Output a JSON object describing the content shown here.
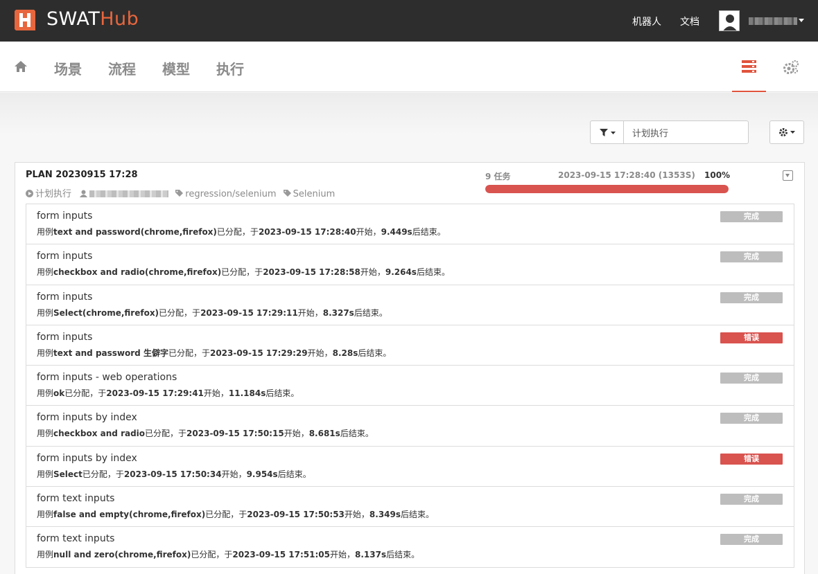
{
  "brand": {
    "part1": "SWAT",
    "part2": "Hub",
    "accent": "#e8663d"
  },
  "topbar": {
    "link_robot": "机器人",
    "link_docs": "文档"
  },
  "nav": {
    "home_icon": "home-icon",
    "items": [
      "场景",
      "流程",
      "模型",
      "执行"
    ],
    "active_icon": "list-icon",
    "settings_icon": "gears-icon"
  },
  "filter": {
    "value": "计划执行"
  },
  "plan": {
    "title": "PLAN 20230915 17:28",
    "type": "计划执行",
    "tag1": "regression/selenium",
    "tag2": "Selenium",
    "task_count": "9 任务",
    "started": "2023-09-15 17:28:40 (1353S)",
    "percent": "100%",
    "progress": 1.0
  },
  "tasks": [
    {
      "name": "form inputs",
      "pre": "用例",
      "case": "text and password(chrome,firefox)",
      "mid": "已分配，于",
      "time": "2023-09-15 17:28:40",
      "mid2": "开始，",
      "dur": "9.449s",
      "post": "后结束。",
      "status": "完成",
      "state": "done"
    },
    {
      "name": "form inputs",
      "pre": "用例",
      "case": "checkbox and radio(chrome,firefox)",
      "mid": "已分配，于",
      "time": "2023-09-15 17:28:58",
      "mid2": "开始，",
      "dur": "9.264s",
      "post": "后结束。",
      "status": "完成",
      "state": "done"
    },
    {
      "name": "form inputs",
      "pre": "用例",
      "case": "Select(chrome,firefox)",
      "mid": "已分配，于",
      "time": "2023-09-15 17:29:11",
      "mid2": "开始，",
      "dur": "8.327s",
      "post": "后结束。",
      "status": "完成",
      "state": "done"
    },
    {
      "name": "form inputs",
      "pre": "用例",
      "case": "text and password 生僻字",
      "mid": "已分配，于",
      "time": "2023-09-15 17:29:29",
      "mid2": "开始，",
      "dur": "8.28s",
      "post": "后结束。",
      "status": "错误",
      "state": "err"
    },
    {
      "name": "form inputs - web operations",
      "pre": "用例",
      "case": "ok",
      "mid": "已分配，于",
      "time": "2023-09-15 17:29:41",
      "mid2": "开始，",
      "dur": "11.184s",
      "post": "后结束。",
      "status": "完成",
      "state": "done"
    },
    {
      "name": "form inputs by index",
      "pre": "用例",
      "case": "checkbox and radio",
      "mid": "已分配，于",
      "time": "2023-09-15 17:50:15",
      "mid2": "开始，",
      "dur": "8.681s",
      "post": "后结束。",
      "status": "完成",
      "state": "done"
    },
    {
      "name": "form inputs by index",
      "pre": "用例",
      "case": "Select",
      "mid": "已分配，于",
      "time": "2023-09-15 17:50:34",
      "mid2": "开始，",
      "dur": "9.954s",
      "post": "后结束。",
      "status": "错误",
      "state": "err"
    },
    {
      "name": "form text inputs",
      "pre": "用例",
      "case": "false and empty(chrome,firefox)",
      "mid": "已分配，于",
      "time": "2023-09-15 17:50:53",
      "mid2": "开始，",
      "dur": "8.349s",
      "post": "后结束。",
      "status": "完成",
      "state": "done"
    },
    {
      "name": "form text inputs",
      "pre": "用例",
      "case": "null and zero(chrome,firefox)",
      "mid": "已分配，于",
      "time": "2023-09-15 17:51:05",
      "mid2": "开始，",
      "dur": "8.137s",
      "post": "后结束。",
      "status": "完成",
      "state": "done"
    }
  ]
}
